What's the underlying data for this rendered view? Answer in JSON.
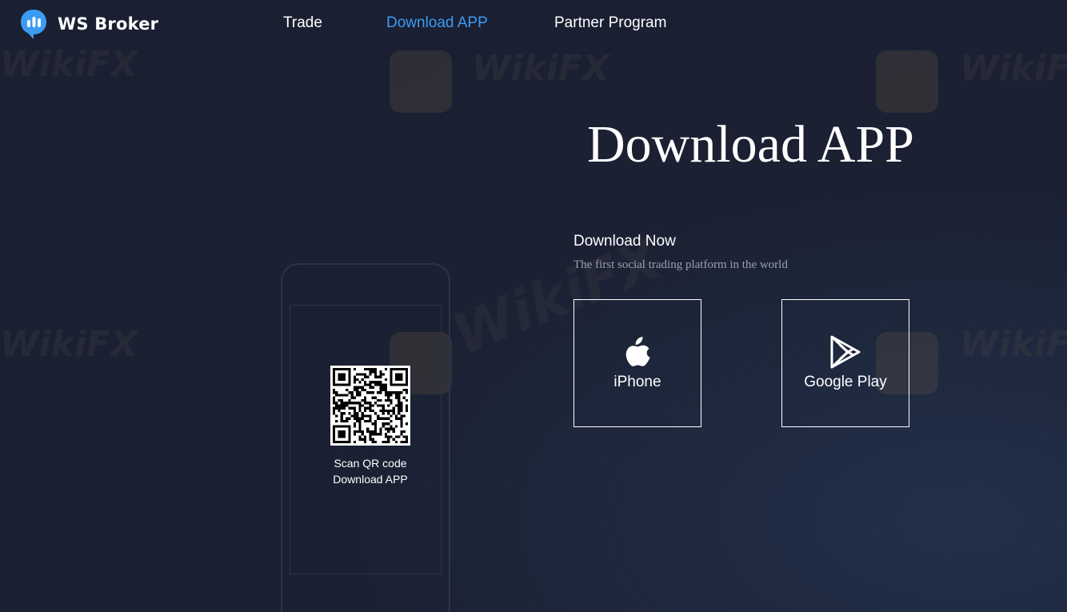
{
  "brand": {
    "name": "WS Broker",
    "accent": "#3b9bf2"
  },
  "nav": {
    "items": [
      {
        "label": "Trade",
        "active": false
      },
      {
        "label": "Download APP",
        "active": true
      },
      {
        "label": "Partner Program",
        "active": false
      }
    ]
  },
  "hero": {
    "title": "Download APP",
    "download_now": "Download Now",
    "subtitle": "The first social trading platform in the world"
  },
  "qr": {
    "caption_line1": "Scan QR code",
    "caption_line2": "Download APP"
  },
  "stores": [
    {
      "label": "iPhone",
      "icon": "apple-icon"
    },
    {
      "label": "Google Play",
      "icon": "google-play-icon"
    }
  ],
  "watermark": {
    "text": "WikiFX"
  }
}
